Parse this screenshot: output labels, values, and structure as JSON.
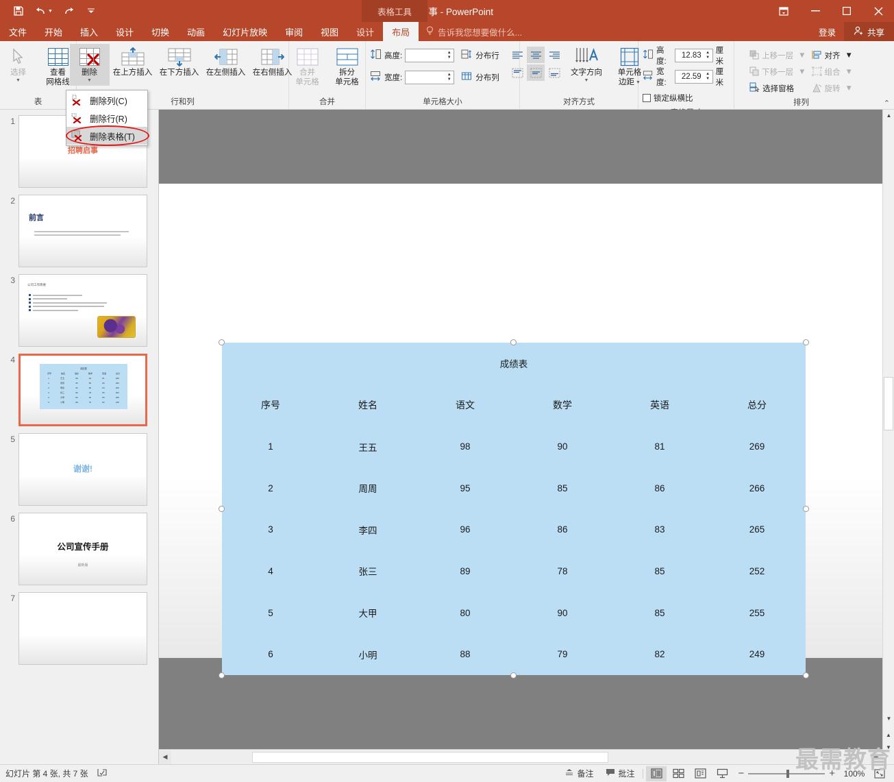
{
  "titlebar": {
    "document_title": "招聘启事 - PowerPoint",
    "context_tool_label": "表格工具",
    "quick_access": [
      {
        "name": "save-icon",
        "glyph": "ὋE"
      },
      {
        "name": "undo-icon",
        "glyph": "↶"
      },
      {
        "name": "redo-icon",
        "glyph": "↷"
      },
      {
        "name": "customize-qat-icon",
        "glyph": "▾"
      }
    ],
    "window_controls": {
      "ribbon_display": "▣",
      "minimize": "—",
      "maximize": "▢",
      "close": "✕"
    }
  },
  "tabs": [
    {
      "label": "文件",
      "active": false,
      "context": false
    },
    {
      "label": "开始",
      "active": false,
      "context": false
    },
    {
      "label": "插入",
      "active": false,
      "context": false
    },
    {
      "label": "设计",
      "active": false,
      "context": false
    },
    {
      "label": "切换",
      "active": false,
      "context": false
    },
    {
      "label": "动画",
      "active": false,
      "context": false
    },
    {
      "label": "幻灯片放映",
      "active": false,
      "context": false
    },
    {
      "label": "审阅",
      "active": false,
      "context": false
    },
    {
      "label": "视图",
      "active": false,
      "context": false
    },
    {
      "label": "设计",
      "active": false,
      "context": true
    },
    {
      "label": "布局",
      "active": true,
      "context": true
    }
  ],
  "tellme": {
    "placeholder": "告诉我您想要做什么...",
    "icon": "bulb-icon"
  },
  "account": {
    "signin_label": "登录",
    "share_label": "共享"
  },
  "ribbon": {
    "groups": [
      {
        "name": "table",
        "label": "表",
        "buttons": [
          {
            "label": "选择",
            "icon": "cursor-select-icon",
            "disabled": true,
            "has_caret": true
          },
          {
            "label": "查看\n网格线",
            "label_line1": "查看",
            "label_line2": "网格线",
            "icon": "view-gridlines-icon",
            "disabled": false
          }
        ]
      },
      {
        "name": "rows-and-columns",
        "label": "行和列",
        "buttons": [
          {
            "label": "删除",
            "icon": "delete-table-icon",
            "pressed": true,
            "has_caret": true
          },
          {
            "label": "在上方插入",
            "icon": "insert-above-icon"
          },
          {
            "label": "在下方插入",
            "icon": "insert-below-icon"
          },
          {
            "label": "在左侧插入",
            "icon": "insert-left-icon"
          },
          {
            "label": "在右侧插入",
            "icon": "insert-right-icon"
          }
        ]
      },
      {
        "name": "merge",
        "label": "合并",
        "buttons": [
          {
            "label_line1": "合并",
            "label_line2": "单元格",
            "icon": "merge-cells-icon",
            "disabled": true
          },
          {
            "label_line1": "拆分",
            "label_line2": "单元格",
            "icon": "split-cells-icon",
            "disabled": false
          }
        ]
      },
      {
        "name": "cell-size",
        "label": "单元格大小",
        "height_label": "高度:",
        "height_value": "",
        "width_label": "宽度:",
        "width_value": "",
        "distribute_rows": "分布行",
        "distribute_cols": "分布列"
      },
      {
        "name": "alignment",
        "label": "对齐方式",
        "text_direction": "文字方向",
        "cell_margin_l1": "单元格",
        "cell_margin_l2": "边距"
      },
      {
        "name": "table-size",
        "label": "表格尺寸",
        "height_label": "高度:",
        "height_value": "12.83",
        "height_unit": "厘米",
        "width_label": "宽度:",
        "width_value": "22.59",
        "width_unit": "厘米",
        "lock_aspect": "锁定纵横比"
      },
      {
        "name": "arrange",
        "label": "排列",
        "items": [
          {
            "label": "上移一层",
            "disabled": true,
            "caret": true
          },
          {
            "label": "下移一层",
            "disabled": true,
            "caret": true
          },
          {
            "label": "选择窗格",
            "disabled": false,
            "caret": false
          },
          {
            "label": "对齐",
            "disabled": false,
            "caret": true
          },
          {
            "label": "组合",
            "disabled": true,
            "caret": true
          },
          {
            "label": "旋转",
            "disabled": true,
            "caret": true
          }
        ]
      }
    ],
    "collapse_icon": "chevron-up-icon"
  },
  "dropdown": {
    "items": [
      {
        "label": "删除列(C)",
        "icon": "delete-column-icon",
        "highlighted": false
      },
      {
        "label": "删除行(R)",
        "icon": "delete-row-icon",
        "highlighted": false
      },
      {
        "label": "删除表格(T)",
        "icon": "delete-table-icon",
        "highlighted": true
      }
    ],
    "annotation_color": "#e01b1b"
  },
  "thumbnails": [
    {
      "num": "1",
      "kind": "title-red",
      "title": "招聘启事",
      "selected": false
    },
    {
      "num": "2",
      "kind": "heading-body",
      "title": "前言",
      "selected": false
    },
    {
      "num": "3",
      "kind": "bullets-image",
      "title": "公司工作简要",
      "selected": false
    },
    {
      "num": "4",
      "kind": "table",
      "title": "成绩表",
      "selected": true
    },
    {
      "num": "5",
      "kind": "thanks",
      "title": "谢谢!",
      "selected": false
    },
    {
      "num": "6",
      "kind": "cover",
      "title": "公司宣传手册",
      "subtitle": "最新版",
      "selected": false
    },
    {
      "num": "7",
      "kind": "blank",
      "title": "",
      "selected": false
    }
  ],
  "slide_table": {
    "caption": "成绩表",
    "columns": [
      "序号",
      "姓名",
      "语文",
      "数学",
      "英语",
      "总分"
    ],
    "rows": [
      [
        "1",
        "王五",
        "98",
        "90",
        "81",
        "269"
      ],
      [
        "2",
        "周周",
        "95",
        "85",
        "86",
        "266"
      ],
      [
        "3",
        "李四",
        "96",
        "86",
        "83",
        "265"
      ],
      [
        "4",
        "张三",
        "89",
        "78",
        "85",
        "252"
      ],
      [
        "5",
        "大甲",
        "80",
        "90",
        "85",
        "255"
      ],
      [
        "6",
        "小明",
        "88",
        "79",
        "82",
        "249"
      ]
    ],
    "fill_color": "#bbdef4"
  },
  "statusbar": {
    "slide_info": "幻灯片 第 4 张, 共 7 张",
    "language_icon": "spellcheck-icon",
    "notes_label": "备注",
    "comments_label": "批注",
    "views": [
      {
        "name": "normal-view",
        "active": true
      },
      {
        "name": "slide-sorter-view",
        "active": false
      },
      {
        "name": "reading-view",
        "active": false
      },
      {
        "name": "slideshow-view",
        "active": false
      }
    ],
    "zoom_out": "−",
    "zoom_in": "+",
    "zoom_value": "100%",
    "fit_slide_icon": "fit-to-window-icon"
  },
  "watermark": "最需教育"
}
